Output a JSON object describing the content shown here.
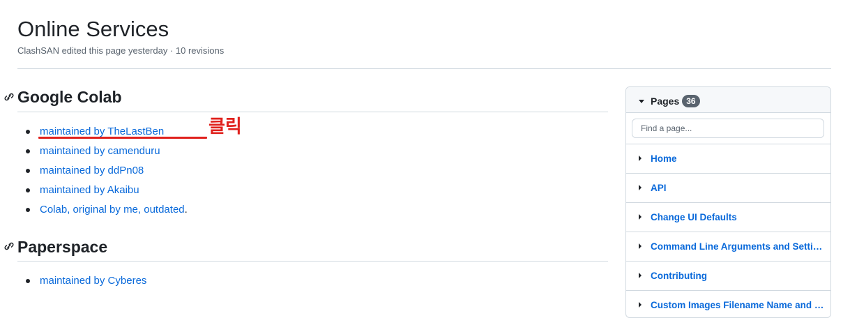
{
  "header": {
    "title": "Online Services",
    "meta": "ClashSAN edited this page yesterday · 10 revisions"
  },
  "sections": [
    {
      "heading": "Google Colab",
      "links": [
        {
          "text": "maintained by TheLastBen"
        },
        {
          "text": "maintained by camenduru"
        },
        {
          "text": "maintained by ddPn08"
        },
        {
          "text": "maintained by Akaibu"
        },
        {
          "text": "Colab, original by me, outdated",
          "suffix": "."
        }
      ]
    },
    {
      "heading": "Paperspace",
      "links": [
        {
          "text": "maintained by Cyberes"
        }
      ]
    }
  ],
  "annotation": {
    "text": "클릭",
    "color": "#e0211d"
  },
  "sidebar": {
    "pages_label": "Pages",
    "pages_count": "36",
    "find_placeholder": "Find a page...",
    "items": [
      {
        "label": "Home"
      },
      {
        "label": "API"
      },
      {
        "label": "Change UI Defaults"
      },
      {
        "label": "Command Line Arguments and Settings"
      },
      {
        "label": "Contributing"
      },
      {
        "label": "Custom Images Filename Name and Subdirectory"
      }
    ]
  },
  "colors": {
    "link": "#0969da",
    "text": "#1f2328",
    "muted": "#59636e",
    "border": "#d1d9e0"
  }
}
